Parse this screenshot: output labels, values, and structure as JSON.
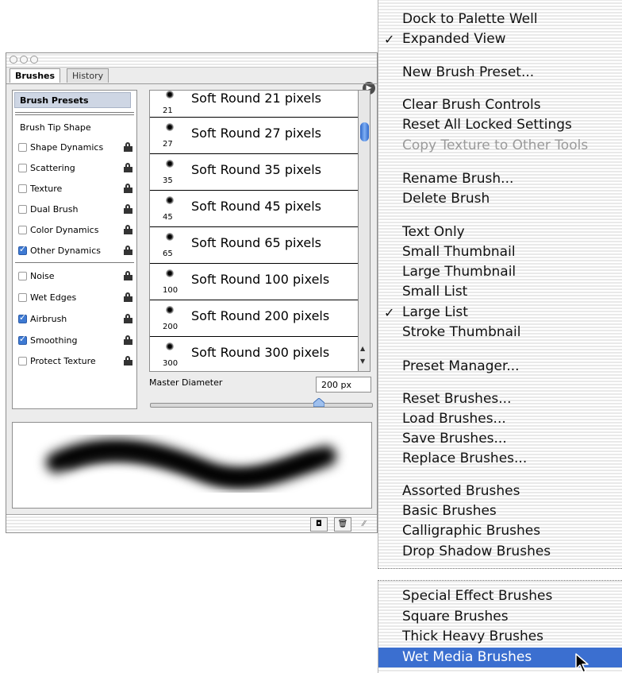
{
  "palette": {
    "tabs": {
      "active": "Brushes",
      "inactive": "History"
    },
    "brush_presets_label": "Brush Presets",
    "brush_tip_shape_label": "Brush Tip Shape",
    "options": [
      {
        "label": "Shape Dynamics",
        "checked": false
      },
      {
        "label": "Scattering",
        "checked": false
      },
      {
        "label": "Texture",
        "checked": false
      },
      {
        "label": "Dual Brush",
        "checked": false
      },
      {
        "label": "Color Dynamics",
        "checked": false
      },
      {
        "label": "Other Dynamics",
        "checked": true
      },
      {
        "label": "Noise",
        "checked": false
      },
      {
        "label": "Wet Edges",
        "checked": false
      },
      {
        "label": "Airbrush",
        "checked": true
      },
      {
        "label": "Smoothing",
        "checked": true
      },
      {
        "label": "Protect Texture",
        "checked": false
      }
    ],
    "brushes": [
      {
        "size": "21",
        "name": "Soft Round 21 pixels"
      },
      {
        "size": "27",
        "name": "Soft Round 27 pixels"
      },
      {
        "size": "35",
        "name": "Soft Round 35 pixels"
      },
      {
        "size": "45",
        "name": "Soft Round 45 pixels"
      },
      {
        "size": "65",
        "name": "Soft Round 65 pixels"
      },
      {
        "size": "100",
        "name": "Soft Round 100 pixels"
      },
      {
        "size": "200",
        "name": "Soft Round 200 pixels"
      },
      {
        "size": "300",
        "name": "Soft Round 300 pixels"
      }
    ],
    "master_diameter_label": "Master Diameter",
    "master_diameter_value": "200 px",
    "selection_color": "#ced6e4",
    "checkbox_color": "#3e7ad3"
  },
  "menu": {
    "highlight_color": "#3b6fd0",
    "items": {
      "dock": "Dock to Palette Well",
      "expanded": "Expanded View",
      "new_preset": "New Brush Preset...",
      "clear_controls": "Clear Brush Controls",
      "reset_locked": "Reset All Locked Settings",
      "copy_texture": "Copy Texture to Other Tools",
      "rename": "Rename Brush...",
      "delete": "Delete Brush",
      "text_only": "Text Only",
      "small_thumb": "Small Thumbnail",
      "large_thumb": "Large Thumbnail",
      "small_list": "Small List",
      "large_list": "Large List",
      "stroke_thumb": "Stroke Thumbnail",
      "preset_manager": "Preset Manager...",
      "reset_brushes": "Reset Brushes...",
      "load_brushes": "Load Brushes...",
      "save_brushes": "Save Brushes...",
      "replace_brushes": "Replace Brushes...",
      "assorted": "Assorted Brushes",
      "basic": "Basic Brushes",
      "calligraphic": "Calligraphic Brushes",
      "drop_shadow": "Drop Shadow Brushes",
      "special_effect": "Special Effect Brushes",
      "square": "Square Brushes",
      "thick_heavy": "Thick Heavy Brushes",
      "wet_media": "Wet Media Brushes"
    },
    "checkmark": "✓"
  }
}
